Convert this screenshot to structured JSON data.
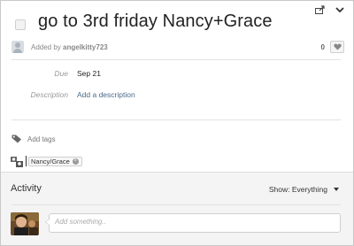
{
  "task": {
    "title": "go to 3rd friday Nancy+Grace",
    "added_prefix": "Added by ",
    "added_by": "angelkitty723",
    "heart_count": "0"
  },
  "fields": {
    "due_label": "Due",
    "due_value": "Sep 21",
    "description_label": "Description",
    "description_link": "Add a description"
  },
  "tags": {
    "add_label": "Add tags"
  },
  "followers": {
    "chips": [
      "Nancy/Grace"
    ]
  },
  "activity": {
    "title": "Activity",
    "filter_label": "Show: Everything",
    "comment_placeholder": "Add something.."
  },
  "icons": {
    "share": "share-icon",
    "collapse": "chevron-down-icon",
    "heart": "heart-icon",
    "tag": "tag-icon",
    "followers": "people-icon",
    "chip_remove": "close-icon"
  },
  "colors": {
    "link": "#4a6a8a",
    "activity_bg": "#f4f4f4"
  }
}
